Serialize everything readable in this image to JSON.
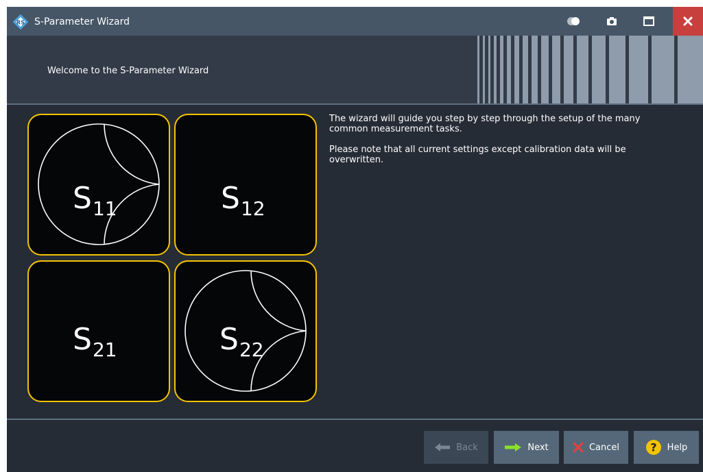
{
  "window": {
    "title": "S-Parameter Wizard",
    "title_icon": "rohde-schwarz-logo-icon",
    "controls": [
      "toggle-icon",
      "camera-icon",
      "maximize-icon",
      "close-icon"
    ],
    "close_color": "#c8403d"
  },
  "header": {
    "welcome_text": "Welcome to the S-Parameter Wizard"
  },
  "tiles": [
    {
      "name": "S11",
      "base": "S",
      "sub": "11",
      "smith_chart": true
    },
    {
      "name": "S12",
      "base": "S",
      "sub": "12",
      "smith_chart": false
    },
    {
      "name": "S21",
      "base": "S",
      "sub": "21",
      "smith_chart": false
    },
    {
      "name": "S22",
      "base": "S",
      "sub": "22",
      "smith_chart": true
    }
  ],
  "tile_border_color": "#f5c400",
  "description": {
    "paragraph1": "The wizard will guide you step by step through the setup of the many common measurement tasks.",
    "paragraph2": "Please note that all current settings except calibration data will be overwritten."
  },
  "buttons": {
    "back": {
      "label": "Back",
      "icon": "arrow-left-icon",
      "enabled": false
    },
    "next": {
      "label": "Next",
      "icon": "arrow-right-icon",
      "enabled": true
    },
    "cancel": {
      "label": "Cancel",
      "icon": "x-icon",
      "enabled": true
    },
    "help": {
      "label": "Help",
      "icon": "question-icon",
      "enabled": true
    }
  }
}
